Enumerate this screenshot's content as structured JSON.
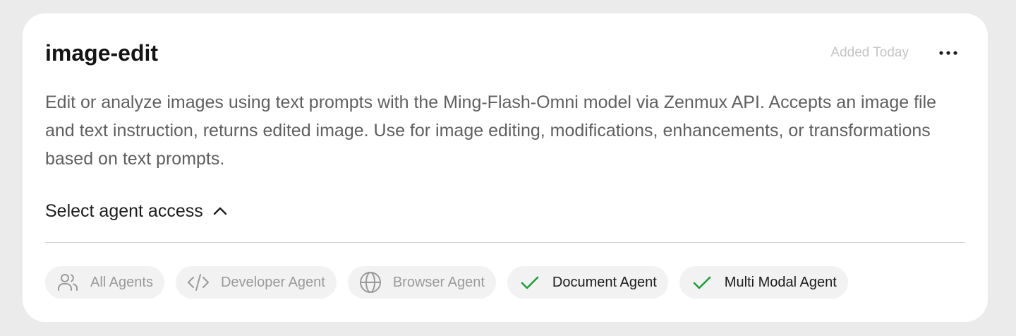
{
  "skill": {
    "name": "image-edit",
    "added": "Added Today",
    "description": "Edit or analyze images using text prompts with the Ming-Flash-Omni model via Zenmux API. Accepts an image file and text instruction, returns edited image. Use for image editing, modifications, enhancements, or transformations based on text prompts."
  },
  "access": {
    "label": "Select agent access",
    "expanded": true,
    "agents": [
      {
        "label": "All Agents",
        "icon": "users-icon",
        "selected": false
      },
      {
        "label": "Developer Agent",
        "icon": "code-icon",
        "selected": false
      },
      {
        "label": "Browser Agent",
        "icon": "globe-icon",
        "selected": false
      },
      {
        "label": "Document Agent",
        "icon": "check-icon",
        "selected": true
      },
      {
        "label": "Multi Modal Agent",
        "icon": "check-icon",
        "selected": true
      }
    ]
  },
  "colors": {
    "check": "#1f9d3a",
    "muted_icon": "#9a9a9a",
    "card_bg": "#ffffff",
    "page_bg": "#ebebeb"
  }
}
